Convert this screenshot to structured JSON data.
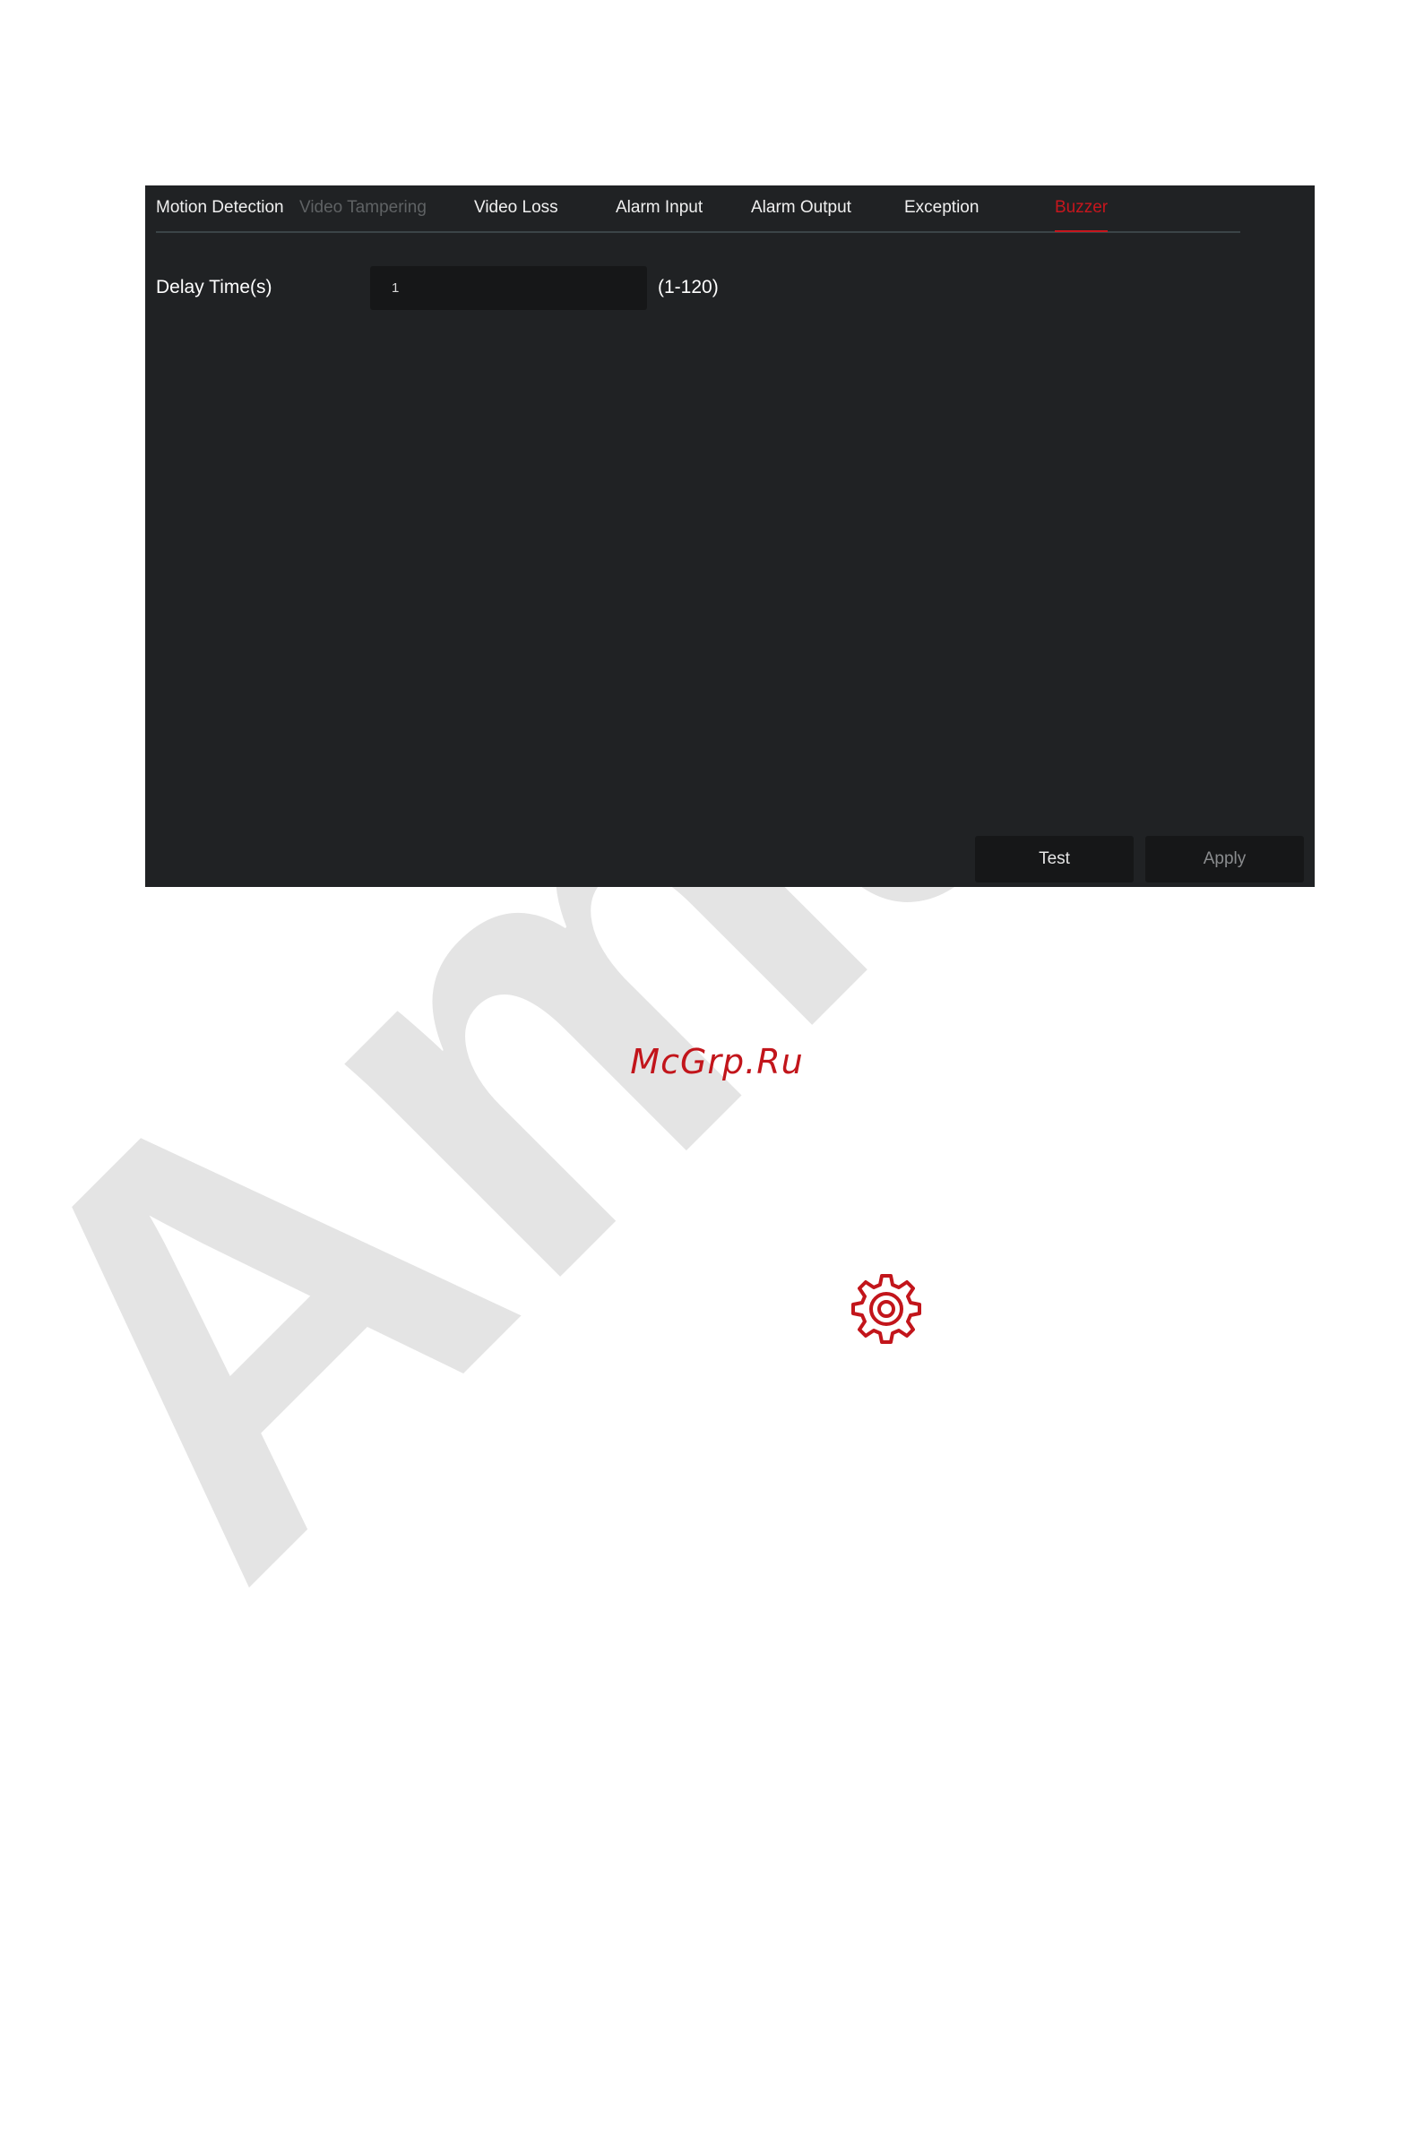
{
  "watermark": {
    "text": "Amal"
  },
  "tabs": [
    {
      "label": "Motion Detection",
      "state": "normal"
    },
    {
      "label": "Video Tampering",
      "state": "disabled"
    },
    {
      "label": "Video Loss",
      "state": "normal"
    },
    {
      "label": "Alarm Input",
      "state": "normal"
    },
    {
      "label": "Alarm Output",
      "state": "normal"
    },
    {
      "label": "Exception",
      "state": "normal"
    },
    {
      "label": "Buzzer",
      "state": "active"
    }
  ],
  "delay": {
    "label": "Delay Time(s)",
    "value": "1",
    "range": "(1-120)"
  },
  "buttons": {
    "test": "Test",
    "apply": "Apply"
  },
  "footer": {
    "site": "McGrp.Ru",
    "icon": "gear-icon"
  },
  "colors": {
    "accent": "#c7161d",
    "panel": "#202224",
    "input": "#161718"
  }
}
